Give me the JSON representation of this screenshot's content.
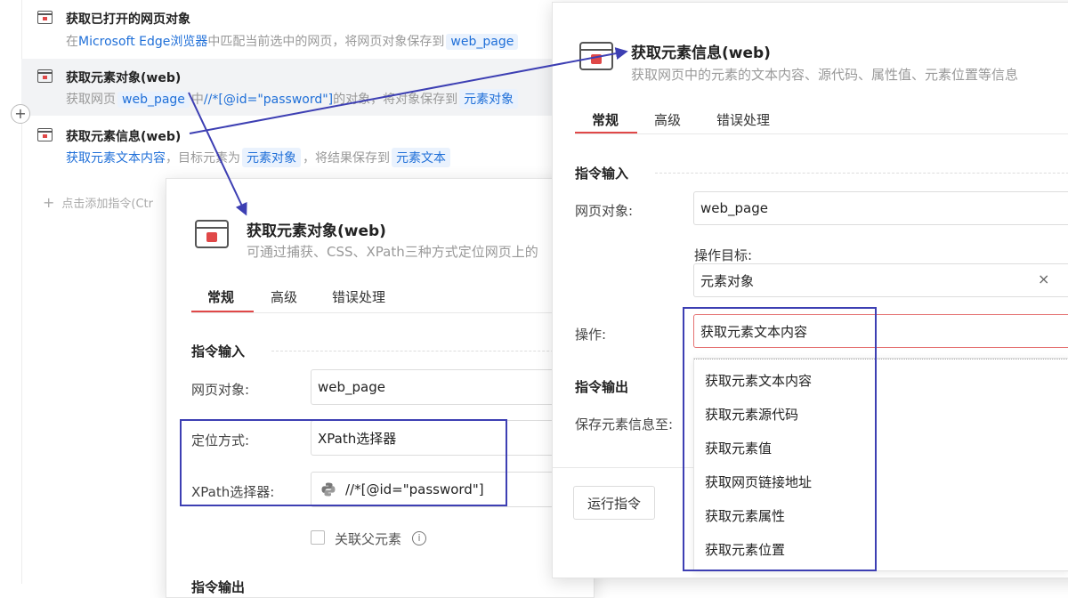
{
  "command_list": {
    "items": [
      {
        "title": "获取已打开的网页对象",
        "desc_parts": [
          {
            "text": "在",
            "style": "plain"
          },
          {
            "text": "Microsoft Edge浏览器",
            "style": "hl"
          },
          {
            "text": "中匹配当前选中的网页，将网页对象保存到",
            "style": "plain"
          },
          {
            "text": "web_page",
            "style": "tag"
          }
        ]
      },
      {
        "title": "获取元素对象(web)",
        "desc_parts": [
          {
            "text": "获取网页",
            "style": "plain"
          },
          {
            "text": "web_page",
            "style": "tag"
          },
          {
            "text": "中",
            "style": "plain"
          },
          {
            "text": "//*[@id=\"password\"]",
            "style": "hl"
          },
          {
            "text": "的对象，将对象保存到",
            "style": "plain"
          },
          {
            "text": "元素对象",
            "style": "tag"
          }
        ]
      },
      {
        "title": "获取元素信息(web)",
        "desc_parts": [
          {
            "text": "获取元素文本内容",
            "style": "hl"
          },
          {
            "text": "，目标元素为",
            "style": "plain"
          },
          {
            "text": "元素对象",
            "style": "tag"
          },
          {
            "text": "，将结果保存到",
            "style": "plain"
          },
          {
            "text": "元素文本",
            "style": "tag"
          }
        ]
      }
    ],
    "add_command": "点击添加指令(Ctr",
    "plus_glyph": "+"
  },
  "dialog_left": {
    "title": "获取元素对象(web)",
    "subtitle": "可通过捕获、CSS、XPath三种方式定位网页上的",
    "tabs": [
      "常规",
      "高级",
      "错误处理"
    ],
    "section_input": "指令输入",
    "fields": {
      "web_page_label": "网页对象:",
      "web_page_value": "web_page",
      "locate_label": "定位方式:",
      "locate_value": "XPath选择器",
      "xpath_label": "XPath选择器:",
      "xpath_value": "//*[@id=\"password\"]"
    },
    "checkbox_label": "关联父元素",
    "info_glyph": "i",
    "section_output_partial": "指令输出"
  },
  "dialog_right": {
    "title": "获取元素信息(web)",
    "subtitle": "获取网页中的元素的文本内容、源代码、属性值、元素位置等信息",
    "tabs": [
      "常规",
      "高级",
      "错误处理"
    ],
    "section_input": "指令输入",
    "fields": {
      "web_page_label": "网页对象:",
      "web_page_value": "web_page",
      "target_label": "操作目标:",
      "target_value": "元素对象",
      "op_label": "操作:",
      "op_value": "获取元素文本内容"
    },
    "clear_glyph": "×",
    "section_output": "指令输出",
    "save_label": "保存元素信息至:",
    "run_button": "运行指令",
    "dropdown_options": [
      "获取元素文本内容",
      "获取元素源代码",
      "获取元素值",
      "获取网页链接地址",
      "获取元素属性",
      "获取元素位置"
    ]
  },
  "colors": {
    "accent_red": "#e04848",
    "link_blue": "#1f6fd8",
    "annotation": "#3d3fb3"
  }
}
